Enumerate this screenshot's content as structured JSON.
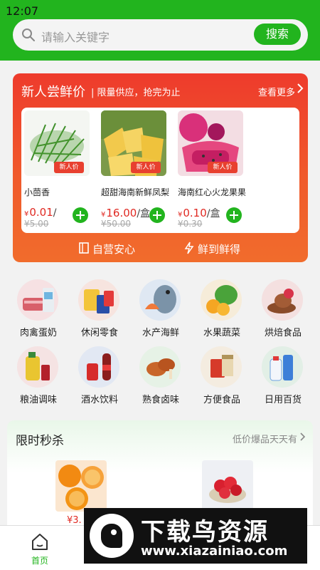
{
  "status_bar": {
    "time": "12:07"
  },
  "search": {
    "placeholder": "请输入关键字",
    "button": "搜索"
  },
  "promo": {
    "title": "新人尝鲜价",
    "subtitle": "| 限量供应，抢完为止",
    "more": "查看更多",
    "tag": "新人价",
    "products": [
      {
        "name": "小茴香",
        "price": "0.01",
        "unit": "/",
        "old_price": "¥5.00"
      },
      {
        "name": "超甜海南新鲜凤梨",
        "price": "16.00",
        "unit": "/盒",
        "old_price": "¥50.00"
      },
      {
        "name": "海南红心火龙果果",
        "price": "0.10",
        "unit": "/盒",
        "old_price": "¥0.30"
      }
    ],
    "footer_left": "自营安心",
    "footer_right": "鲜到鲜得"
  },
  "currency": "¥",
  "categories": [
    {
      "label": "肉禽蛋奶",
      "icon": "meat-icon"
    },
    {
      "label": "休闲零食",
      "icon": "snacks-icon"
    },
    {
      "label": "水产海鲜",
      "icon": "seafood-icon"
    },
    {
      "label": "水果蔬菜",
      "icon": "fruit-vegetable-icon"
    },
    {
      "label": "烘焙食品",
      "icon": "bakery-icon"
    },
    {
      "label": "粮油调味",
      "icon": "grain-oil-icon"
    },
    {
      "label": "酒水饮料",
      "icon": "drinks-icon"
    },
    {
      "label": "熟食卤味",
      "icon": "cooked-food-icon"
    },
    {
      "label": "方便食品",
      "icon": "instant-food-icon"
    },
    {
      "label": "日用百货",
      "icon": "daily-goods-icon"
    }
  ],
  "flash_sale": {
    "title": "限时秒杀",
    "more": "低价爆品天天有",
    "first_price": "3."
  },
  "bottom_nav": [
    {
      "label": "首页",
      "icon": "home-icon",
      "active": true
    },
    {
      "label": "",
      "icon": "category-icon",
      "active": false
    },
    {
      "label": "",
      "icon": "cart-icon",
      "active": false
    },
    {
      "label": "",
      "icon": "profile-icon",
      "active": false
    }
  ],
  "watermark": {
    "title": "下载鸟资源",
    "url": "www.xiazainiao.com"
  },
  "colors": {
    "primary": "#22b41e",
    "promo_red": "#ee3b2c",
    "price_red": "#e02a23"
  }
}
